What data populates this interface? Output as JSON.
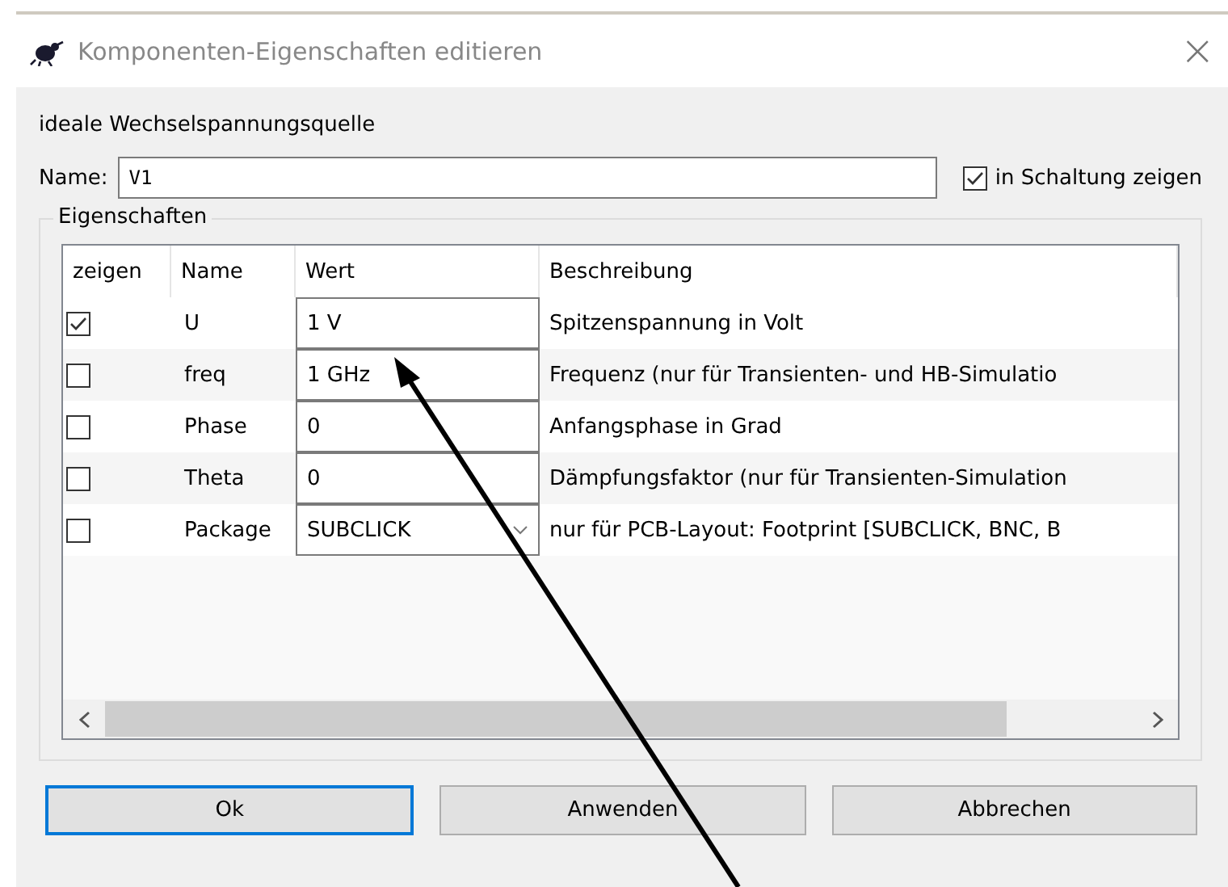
{
  "window": {
    "title": "Komponenten-Eigenschaften editieren",
    "close": "×"
  },
  "component_label": "ideale Wechselspannungsquelle",
  "name_field": {
    "label": "Name:",
    "value": "V1"
  },
  "show_in_circuit": {
    "label": "in Schaltung zeigen",
    "checked": true
  },
  "properties_group": {
    "title": "Eigenschaften"
  },
  "table": {
    "columns": [
      "zeigen",
      "Name",
      "Wert",
      "Beschreibung"
    ],
    "rows": [
      {
        "show": true,
        "name": "U",
        "value": "1 V",
        "kind": "text",
        "description": "Spitzenspannung in Volt"
      },
      {
        "show": false,
        "name": "freq",
        "value": "1 GHz",
        "kind": "text",
        "description": "Frequenz (nur für Transienten- und HB-Simulatio"
      },
      {
        "show": false,
        "name": "Phase",
        "value": "0",
        "kind": "text",
        "description": "Anfangsphase in Grad"
      },
      {
        "show": false,
        "name": "Theta",
        "value": "0",
        "kind": "text",
        "description": "Dämpfungsfaktor (nur für Transienten-Simulation"
      },
      {
        "show": false,
        "name": "Package",
        "value": "SUBCLICK",
        "kind": "dropdown",
        "description": "nur für PCB-Layout: Footprint [SUBCLICK, BNC, B"
      }
    ]
  },
  "buttons": [
    {
      "label": "Ok",
      "selected": true
    },
    {
      "label": "Anwenden",
      "selected": false
    },
    {
      "label": "Abbrechen",
      "selected": false
    }
  ]
}
